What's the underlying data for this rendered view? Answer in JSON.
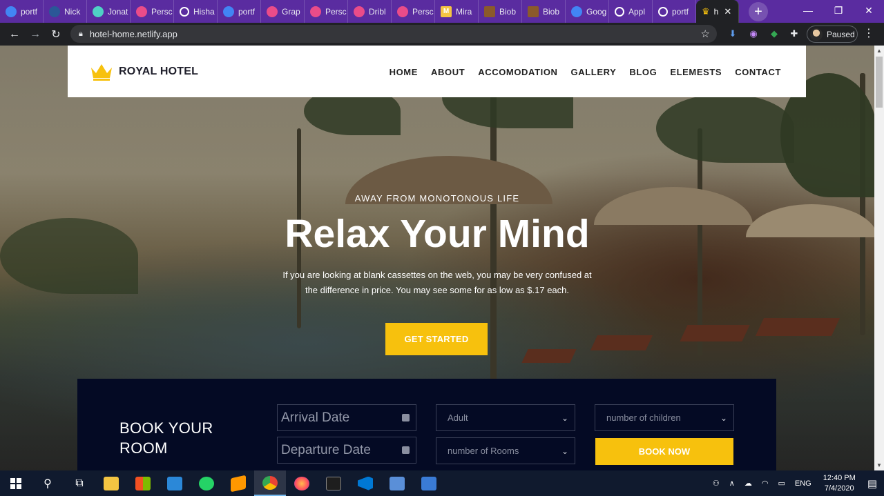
{
  "browser": {
    "tabs": [
      {
        "label": "portf",
        "icon": "google-icon",
        "color": "#4285f4"
      },
      {
        "label": "Nick",
        "icon": "site-icon",
        "color": "#2b5797"
      },
      {
        "label": "Jonat",
        "icon": "circle-icon",
        "color": "#4fd1c5"
      },
      {
        "label": "Persc",
        "icon": "dribbble-icon",
        "color": "#ea4c89"
      },
      {
        "label": "Hisha",
        "icon": "globe-icon",
        "color": "#ffffff"
      },
      {
        "label": "portf",
        "icon": "google-icon",
        "color": "#4285f4"
      },
      {
        "label": "Grap",
        "icon": "dribbble-icon",
        "color": "#ea4c89"
      },
      {
        "label": "Persc",
        "icon": "dribbble-icon",
        "color": "#ea4c89"
      },
      {
        "label": "Dribl",
        "icon": "dribbble-icon",
        "color": "#ea4c89"
      },
      {
        "label": "Persc",
        "icon": "dribbble-icon",
        "color": "#ea4c89"
      },
      {
        "label": "Mira",
        "icon": "m-icon",
        "color": "#f5c542"
      },
      {
        "label": "Biob",
        "icon": "book-icon",
        "color": "#8b5a2b"
      },
      {
        "label": "Biob",
        "icon": "book-icon",
        "color": "#8b5a2b"
      },
      {
        "label": "Goog",
        "icon": "translate-icon",
        "color": "#4285f4"
      },
      {
        "label": "Appl",
        "icon": "globe-icon",
        "color": "#ffffff"
      },
      {
        "label": "portf",
        "icon": "globe-icon",
        "color": "#ffffff"
      }
    ],
    "active_tab": {
      "label": "h",
      "icon": "crown-icon",
      "close": "✕"
    },
    "new_tab": "+",
    "window_controls": {
      "minimize": "—",
      "maximize": "❐",
      "close": "✕"
    },
    "url": "hotel-home.netlify.app",
    "profile_status": "Paused"
  },
  "site": {
    "brand": "ROYAL HOTEL",
    "nav": [
      "HOME",
      "ABOUT",
      "ACCOMODATION",
      "GALLERY",
      "BLOG",
      "ELEMESTS",
      "CONTACT"
    ],
    "accent_color": "#f7c10d",
    "hero": {
      "kicker": "AWAY FROM MONOTONOUS LIFE",
      "title": "Relax Your Mind",
      "text": "If you are looking at blank cassettes on the web, you may be very confused at the difference in price. You may see some for as low as $.17 each.",
      "cta": "GET STARTED"
    },
    "booking": {
      "title": "BOOK YOUR ROOM",
      "arrival_placeholder": "Arrival Date",
      "departure_placeholder": "Departure Date",
      "adult_select": "Adult",
      "rooms_select": "number of Rooms",
      "children_select": "number of children",
      "submit": "BOOK NOW"
    }
  },
  "taskbar": {
    "apps": [
      "windows-start-icon",
      "search-icon",
      "task-view-icon",
      "file-explorer-icon",
      "store-icon",
      "mail-icon",
      "whatsapp-icon",
      "sublime-icon",
      "chrome-icon",
      "firefox-icon",
      "terminal-icon",
      "vscode-icon",
      "installer-icon",
      "photos-icon"
    ],
    "language": "ENG",
    "time": "12:40 PM",
    "date": "7/4/2020"
  }
}
